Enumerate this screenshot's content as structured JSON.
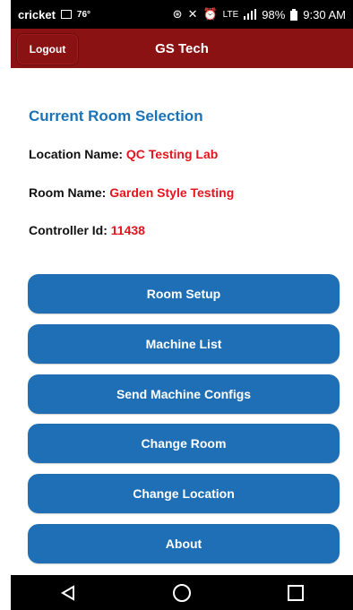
{
  "status_bar": {
    "carrier": "cricket",
    "temperature": "76°",
    "network": "LTE",
    "battery": "98%",
    "time": "9:30 AM"
  },
  "app_bar": {
    "logout_label": "Logout",
    "title": "GS Tech"
  },
  "selection": {
    "heading": "Current Room Selection",
    "location_label": "Location Name:",
    "location_value": "QC Testing Lab",
    "room_label": "Room Name:",
    "room_value": "Garden Style Testing",
    "controller_label": "Controller Id:",
    "controller_value": "11438"
  },
  "menu_buttons": [
    {
      "label": "Room Setup"
    },
    {
      "label": "Machine List"
    },
    {
      "label": "Send Machine Configs"
    },
    {
      "label": "Change Room"
    },
    {
      "label": "Change Location"
    },
    {
      "label": "About"
    }
  ],
  "colors": {
    "app_bar": "#8b1212",
    "button": "#1f6fb6",
    "heading": "#1a73b8",
    "value_red": "#e6141e"
  }
}
